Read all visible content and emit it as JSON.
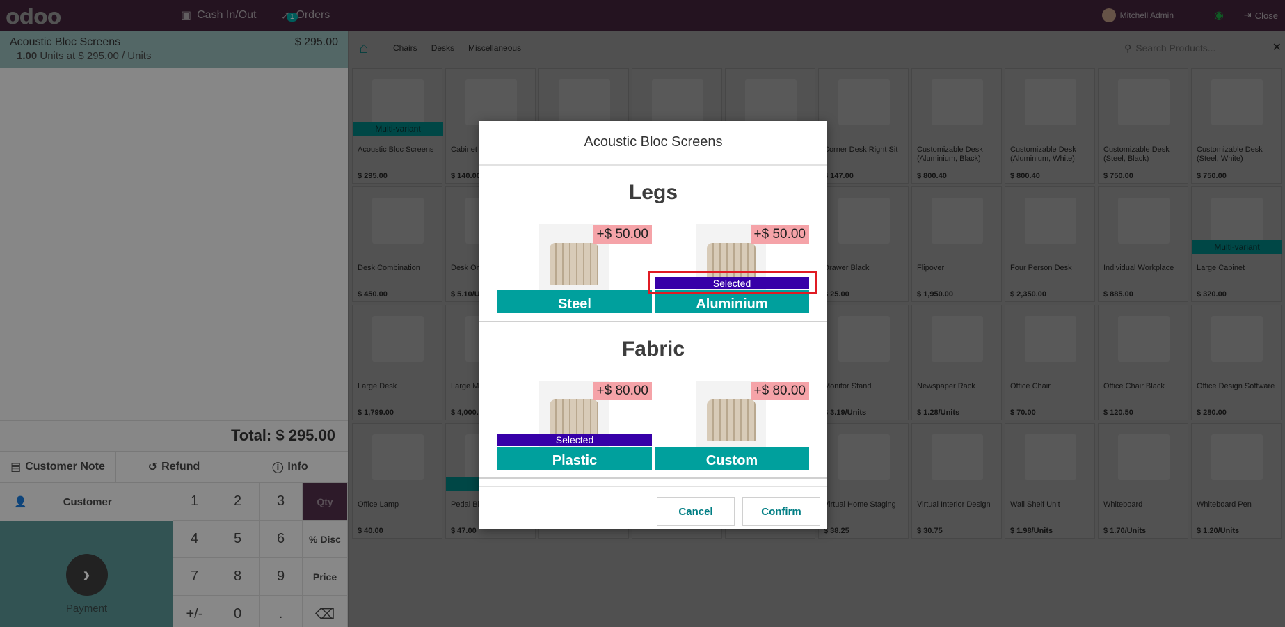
{
  "topbar": {
    "logo": "odoo",
    "cash_label": "Cash In/Out",
    "orders_label": "Orders",
    "orders_badge": "1",
    "user_name": "Mitchell Admin",
    "close_label": "Close"
  },
  "order": {
    "line_name": "Acoustic Bloc Screens",
    "line_price": "$ 295.00",
    "line_qty": "1.00",
    "line_detail": "Units at $ 295.00 / Units",
    "total": "Total: $ 295.00"
  },
  "controls": {
    "customer_note": "Customer Note",
    "refund": "Refund",
    "info": "Info",
    "customer": "Customer",
    "payment": "Payment"
  },
  "keypad": [
    "1",
    "2",
    "3",
    "Qty",
    "4",
    "5",
    "6",
    "% Disc",
    "7",
    "8",
    "9",
    "Price",
    "+/-",
    "0",
    ".",
    "⌫"
  ],
  "categories": [
    "Chairs",
    "Desks",
    "Miscellaneous"
  ],
  "search": {
    "placeholder": "Search Products..."
  },
  "products": [
    {
      "name": "Acoustic Bloc Screens",
      "price": "$ 295.00",
      "variant": "Multi-variant"
    },
    {
      "name": "Cabinet",
      "price": "$ 140.00",
      "variant": ""
    },
    {
      "name": "",
      "price": "",
      "variant": ""
    },
    {
      "name": "",
      "price": "",
      "variant": ""
    },
    {
      "name": "",
      "price": "",
      "variant": ""
    },
    {
      "name": "Corner Desk Right Sit",
      "price": "$ 147.00",
      "variant": ""
    },
    {
      "name": "Customizable Desk (Aluminium, Black)",
      "price": "$ 800.40",
      "variant": ""
    },
    {
      "name": "Customizable Desk (Aluminium, White)",
      "price": "$ 800.40",
      "variant": ""
    },
    {
      "name": "Customizable Desk (Steel, Black)",
      "price": "$ 750.00",
      "variant": ""
    },
    {
      "name": "Customizable Desk (Steel, White)",
      "price": "$ 750.00",
      "variant": ""
    },
    {
      "name": "Desk Combination",
      "price": "$ 450.00",
      "variant": ""
    },
    {
      "name": "Desk Or",
      "price": "$ 5.10/U",
      "variant": ""
    },
    {
      "name": "",
      "price": "",
      "variant": ""
    },
    {
      "name": "",
      "price": "",
      "variant": ""
    },
    {
      "name": "",
      "price": "",
      "variant": ""
    },
    {
      "name": "Drawer Black",
      "price": "$ 25.00",
      "variant": ""
    },
    {
      "name": "Flipover",
      "price": "$ 1,950.00",
      "variant": ""
    },
    {
      "name": "Four Person Desk",
      "price": "$ 2,350.00",
      "variant": ""
    },
    {
      "name": "Individual Workplace",
      "price": "$ 885.00",
      "variant": ""
    },
    {
      "name": "Large Cabinet",
      "price": "$ 320.00",
      "variant": "Multi-variant"
    },
    {
      "name": "Large Desk",
      "price": "$ 1,799.00",
      "variant": ""
    },
    {
      "name": "Large M",
      "price": "$ 4,000.",
      "variant": ""
    },
    {
      "name": "",
      "price": "",
      "variant": ""
    },
    {
      "name": "",
      "price": "",
      "variant": ""
    },
    {
      "name": "",
      "price": "",
      "variant": ""
    },
    {
      "name": "Monitor Stand",
      "price": "$ 3.19/Units",
      "variant": ""
    },
    {
      "name": "Newspaper Rack",
      "price": "$ 1.28/Units",
      "variant": ""
    },
    {
      "name": "Office Chair",
      "price": "$ 70.00",
      "variant": ""
    },
    {
      "name": "Office Chair Black",
      "price": "$ 120.50",
      "variant": ""
    },
    {
      "name": "Office Design Software",
      "price": "$ 280.00",
      "variant": ""
    },
    {
      "name": "Office Lamp",
      "price": "$ 40.00",
      "variant": ""
    },
    {
      "name": "Pedal Bi",
      "price": "$ 47.00",
      "variant": "Mu"
    },
    {
      "name": "",
      "price": "",
      "variant": ""
    },
    {
      "name": "",
      "price": "",
      "variant": ""
    },
    {
      "name": "",
      "price": "",
      "variant": ""
    },
    {
      "name": "Virtual Home Staging",
      "price": "$ 38.25",
      "variant": ""
    },
    {
      "name": "Virtual Interior Design",
      "price": "$ 30.75",
      "variant": ""
    },
    {
      "name": "Wall Shelf Unit",
      "price": "$ 1.98/Units",
      "variant": ""
    },
    {
      "name": "Whiteboard",
      "price": "$ 1.70/Units",
      "variant": ""
    },
    {
      "name": "Whiteboard Pen",
      "price": "$ 1.20/Units",
      "variant": ""
    }
  ],
  "modal": {
    "title": "Acoustic Bloc Screens",
    "attributes": [
      {
        "name": "Legs",
        "options": [
          {
            "label": "Steel",
            "extra": "+$ 50.00",
            "selected": false
          },
          {
            "label": "Aluminium",
            "extra": "+$ 50.00",
            "selected": true
          }
        ]
      },
      {
        "name": "Fabric",
        "options": [
          {
            "label": "Plastic",
            "extra": "+$ 80.00",
            "selected": true
          },
          {
            "label": "Custom",
            "extra": "+$ 80.00",
            "selected": false
          }
        ]
      }
    ],
    "selected_text": "Selected",
    "cancel": "Cancel",
    "confirm": "Confirm"
  },
  "colors": {
    "topbar": "#3e2238",
    "accent": "#00a09d",
    "selected": "#3700a8",
    "price_badge": "#f5a3a8"
  }
}
